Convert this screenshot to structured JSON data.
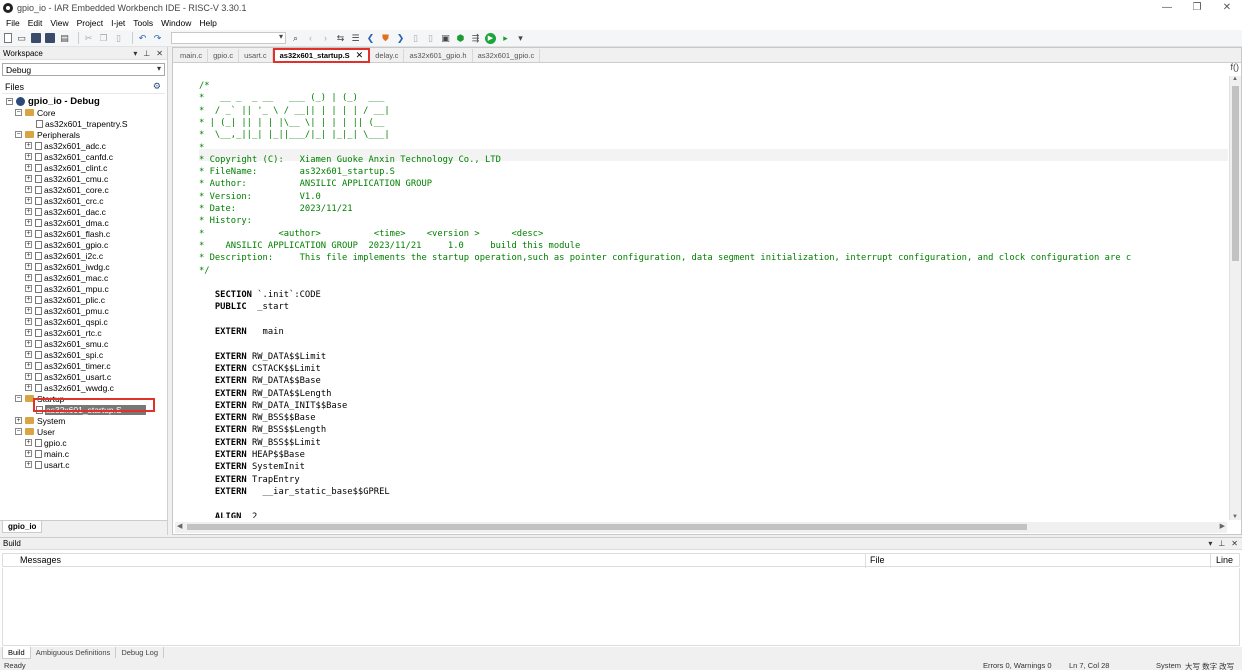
{
  "window": {
    "title": "gpio_io - IAR Embedded Workbench IDE - RISC-V 3.30.1"
  },
  "menu": [
    "File",
    "Edit",
    "View",
    "Project",
    "I-jet",
    "Tools",
    "Window",
    "Help"
  ],
  "workspace": {
    "panel_title": "Workspace",
    "configuration": "Debug",
    "files_header": "Files",
    "project": "gpio_io - Debug",
    "groups": {
      "core": {
        "name": "Core",
        "files": [
          "as32x601_trapentry.S"
        ]
      },
      "peripherals": {
        "name": "Peripherals",
        "files": [
          "as32x601_adc.c",
          "as32x601_canfd.c",
          "as32x601_clint.c",
          "as32x601_cmu.c",
          "as32x601_core.c",
          "as32x601_crc.c",
          "as32x601_dac.c",
          "as32x601_dma.c",
          "as32x601_flash.c",
          "as32x601_gpio.c",
          "as32x601_i2c.c",
          "as32x601_iwdg.c",
          "as32x601_mac.c",
          "as32x601_mpu.c",
          "as32x601_plic.c",
          "as32x601_pmu.c",
          "as32x601_qspi.c",
          "as32x601_rtc.c",
          "as32x601_smu.c",
          "as32x601_spi.c",
          "as32x601_timer.c",
          "as32x601_usart.c",
          "as32x601_wwdg.c"
        ]
      },
      "startup": {
        "name": "Startup",
        "files": [
          "as32x601_startup.S"
        ]
      },
      "system": {
        "name": "System"
      },
      "user": {
        "name": "User",
        "files": [
          "gpio.c",
          "main.c",
          "usart.c"
        ]
      }
    },
    "bottom_tab": "gpio_io"
  },
  "editor": {
    "tabs": [
      "main.c",
      "gpio.c",
      "usart.c",
      "as32x601_startup.S",
      "delay.c",
      "as32x601_gpio.h",
      "as32x601_gpio.c"
    ],
    "active_tab": "as32x601_startup.S",
    "fn_button": "f()",
    "lines": [
      "/*",
      "*   __ _  _ __   ___ (_) | (_)  ___",
      "*  / _` || '_ \\ / __|| | | | | / __|",
      "* | (_| || | | |\\__ \\| | | | || (__",
      "*  \\__,_||_| |_||___/|_| |_|_| \\___|",
      "*",
      "* Copyright (C):   Xiamen Guoke Anxin Technology Co., LTD",
      "* FileName:        as32x601_startup.S",
      "* Author:          ANSILIC APPLICATION GROUP",
      "* Version:         V1.0",
      "* Date:            2023/11/21",
      "* History:",
      "*              <author>          <time>    <version >      <desc>",
      "*    ANSILIC APPLICATION GROUP  2023/11/21     1.0     build this module",
      "* Description:     This file implements the startup operation,such as pointer configuration, data segment initialization, interrupt configuration, and clock configuration are c",
      "*/",
      "",
      "   SECTION `.init`:CODE",
      "   PUBLIC  _start",
      "",
      "   EXTERN   main",
      "",
      "   EXTERN RW_DATA$$Limit",
      "   EXTERN CSTACK$$Limit",
      "   EXTERN RW_DATA$$Base",
      "   EXTERN RW_DATA$$Length",
      "   EXTERN RW_DATA_INIT$$Base",
      "   EXTERN RW_BSS$$Base",
      "   EXTERN RW_BSS$$Length",
      "   EXTERN RW_BSS$$Limit",
      "   EXTERN HEAP$$Base",
      "   EXTERN SystemInit",
      "   EXTERN TrapEntry",
      "   EXTERN   __iar_static_base$$GPREL",
      "",
      "   ALIGN  2"
    ]
  },
  "build": {
    "panel_title": "Build",
    "columns": {
      "messages": "Messages",
      "file": "File",
      "line": "Line"
    }
  },
  "bottom_tabs": [
    "Build",
    "Ambiguous Definitions",
    "Debug Log"
  ],
  "status": {
    "left": "Ready",
    "errors": "Errors 0, Warnings 0",
    "position": "Ln 7, Col 28",
    "encoding": "System",
    "ime": "大写 数字 改写"
  },
  "colors": {
    "comment": "#008000",
    "highlight_border": "#e0312b",
    "selected_bg": "#777777"
  }
}
